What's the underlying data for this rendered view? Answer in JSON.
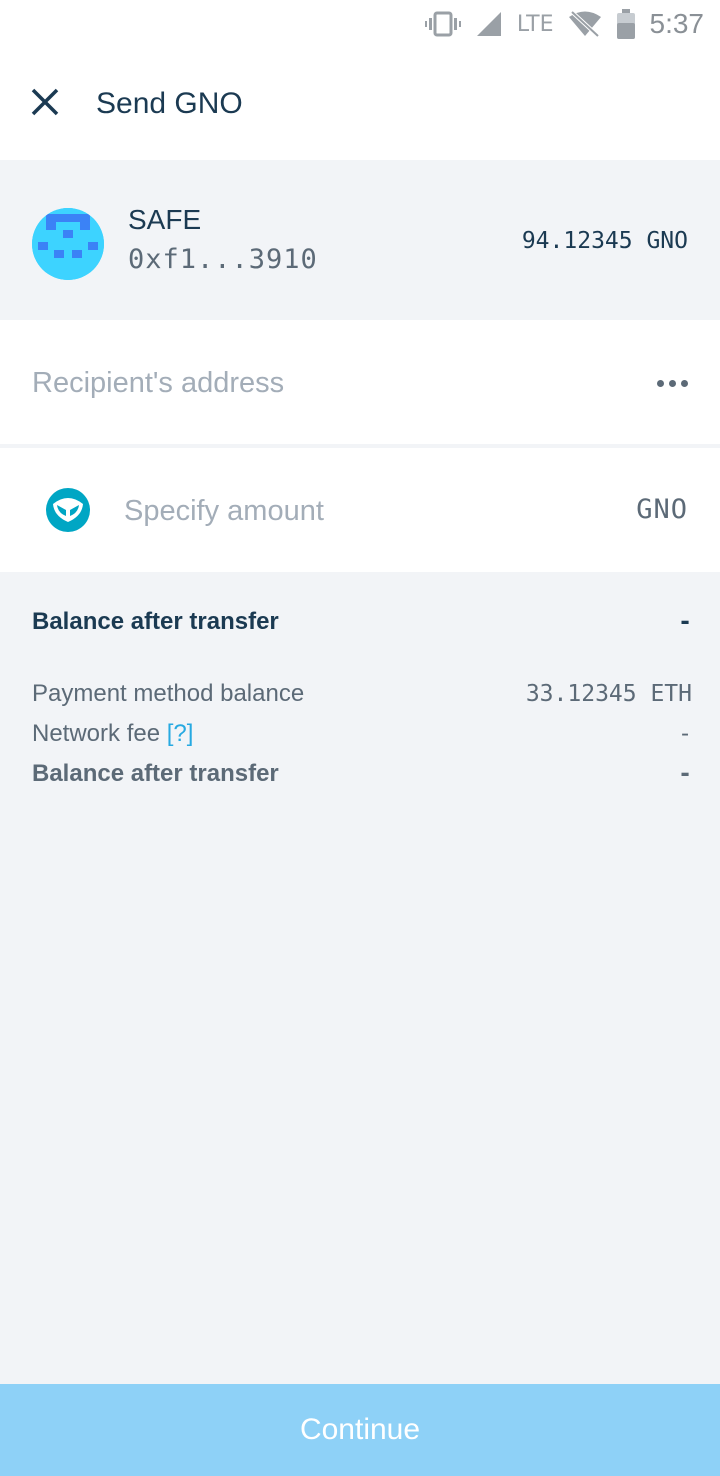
{
  "status_bar": {
    "network": "LTE",
    "time": "5:37",
    "icons": [
      "vibrate-icon",
      "signal-icon",
      "wifi-off-icon",
      "battery-icon"
    ]
  },
  "toolbar": {
    "title": "Send GNO",
    "close_icon": "close-icon"
  },
  "account": {
    "name": "SAFE",
    "address": "0xf1...3910",
    "balance": "94.12345 GNO"
  },
  "recipient": {
    "placeholder": "Recipient's address",
    "value": "",
    "more_icon": "more-horizontal-icon"
  },
  "amount": {
    "placeholder": "Specify amount",
    "value": "",
    "symbol": "GNO",
    "token_icon": "gnosis-owl-icon"
  },
  "summary": {
    "balance_after_label": "Balance after transfer",
    "balance_after_value": "-",
    "payment_balance_label": "Payment method balance",
    "payment_balance_value": "33.12345 ETH",
    "network_fee_label": "Network fee",
    "network_fee_help": "[?]",
    "network_fee_value": "-",
    "balance_after_2_label": "Balance after transfer",
    "balance_after_2_value": "-"
  },
  "continue_label": "Continue",
  "colors": {
    "primary_text": "#1b3a52",
    "secondary_text": "#5c6a77",
    "accent_link": "#27a9e1",
    "button_disabled": "#8ed1f7",
    "background": "#f2f4f7"
  }
}
